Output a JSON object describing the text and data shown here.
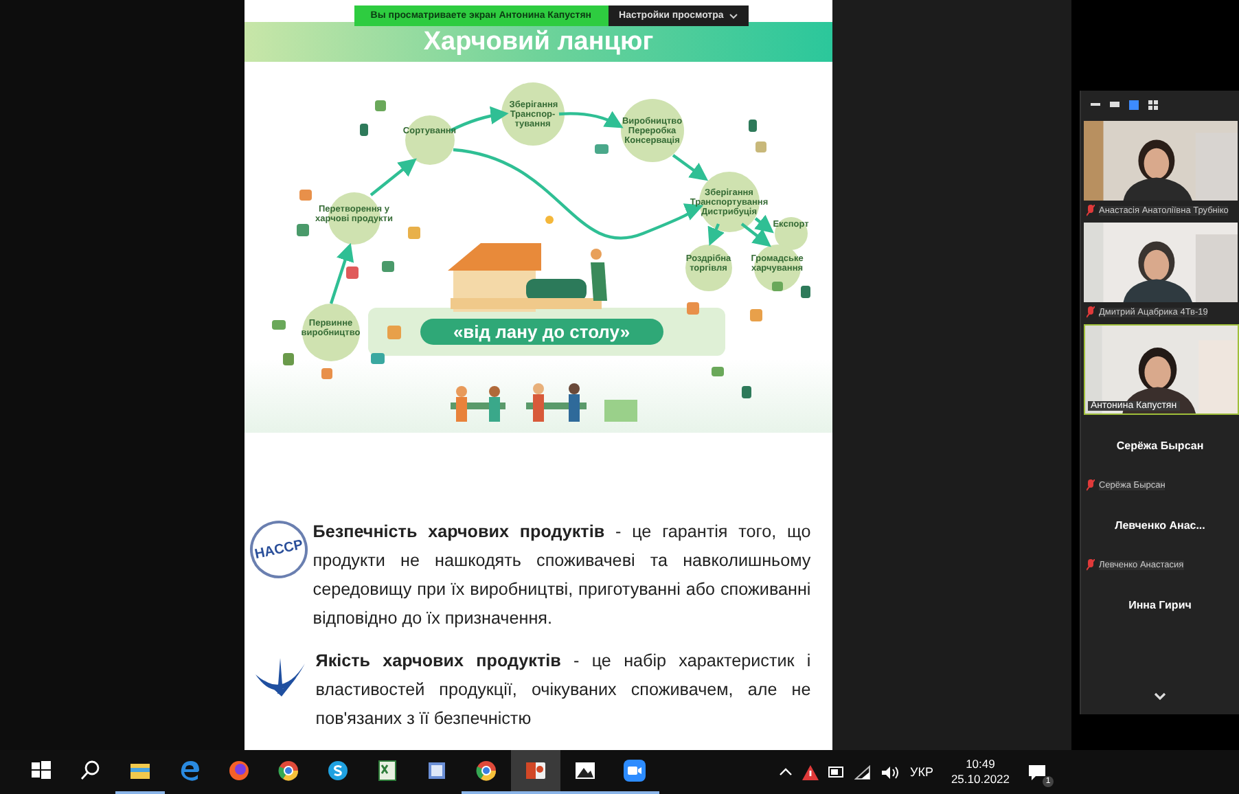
{
  "share_banner": {
    "notice": "Вы просматриваете экран Антонина Капустян",
    "settings": "Настройки просмотра"
  },
  "slide": {
    "title": "Харчовий ланцюг",
    "diagram": {
      "stages": [
        {
          "label": "Сортування"
        },
        {
          "label": "Зберігання Транспор-тування"
        },
        {
          "label": "Виробництво Переробка Консервація"
        },
        {
          "label": "Зберігання Транспортування Дистрибуція"
        },
        {
          "label": "Експорт"
        },
        {
          "label": "Роздрібна торгівля"
        },
        {
          "label": "Громадське харчування"
        },
        {
          "label": "Перетворення у харчові продукти"
        },
        {
          "label": "Первинне виробництво"
        }
      ],
      "motto": "«від лану до столу»"
    },
    "definitions": [
      {
        "kind": "haccp",
        "logo_text": "HACCP",
        "text": "**Безпечність харчових продуктів** - це гарантія того, що продукти не нашкодять споживачеві та навколишньому середовищу при  їх виробництві, приготуванні або  споживанні відповідно до їх призначення."
      },
      {
        "kind": "quality",
        "text": "**Якість харчових продуктів** - це набір характеристик і властивостей продукції,  очікуваних споживачем, але не пов'язаних з її безпечністю"
      }
    ]
  },
  "panel": {
    "view_buttons": [
      {
        "kind": "minimize",
        "selected": false
      },
      {
        "kind": "thumbnail",
        "selected": false
      },
      {
        "kind": "speaker",
        "selected": true
      },
      {
        "kind": "gallery",
        "selected": false
      }
    ],
    "participants": [
      {
        "kind": "video",
        "label": "Анастасія Анатоліївна Трубніко",
        "muted": true,
        "speaking": false
      },
      {
        "kind": "video",
        "label": "Дмитрий Ацабрика 4Тв-19",
        "muted": true,
        "speaking": false
      },
      {
        "kind": "video",
        "label": "Антонина Капустян",
        "muted": false,
        "speaking": true
      },
      {
        "kind": "name",
        "title": "Серёжа Бырсан",
        "label": "Серёжа Бырсан",
        "muted": true
      },
      {
        "kind": "name",
        "title": "Левченко  Анас...",
        "label": "Левченко Анастасия",
        "muted": true
      },
      {
        "kind": "name",
        "title": "Инна Гирич"
      }
    ]
  },
  "taskbar": {
    "apps": [
      {
        "kind": "start",
        "open": false,
        "selected": false
      },
      {
        "kind": "search",
        "open": false,
        "selected": false
      },
      {
        "kind": "explorer",
        "open": true,
        "selected": false
      },
      {
        "kind": "edge",
        "open": false,
        "selected": false
      },
      {
        "kind": "firefox",
        "open": false,
        "selected": false
      },
      {
        "kind": "chrome",
        "open": false,
        "selected": false
      },
      {
        "kind": "skype",
        "open": false,
        "selected": false
      },
      {
        "kind": "sheet",
        "open": false,
        "selected": false
      },
      {
        "kind": "app",
        "open": false,
        "selected": false
      },
      {
        "kind": "chrome",
        "open": true,
        "selected": false
      },
      {
        "kind": "slides",
        "open": true,
        "selected": true
      },
      {
        "kind": "photos",
        "open": true,
        "selected": false
      },
      {
        "kind": "zoom",
        "open": true,
        "selected": false
      }
    ],
    "language": "УКР",
    "time": "10:49",
    "date": "25.10.2022",
    "notifications": "1"
  }
}
